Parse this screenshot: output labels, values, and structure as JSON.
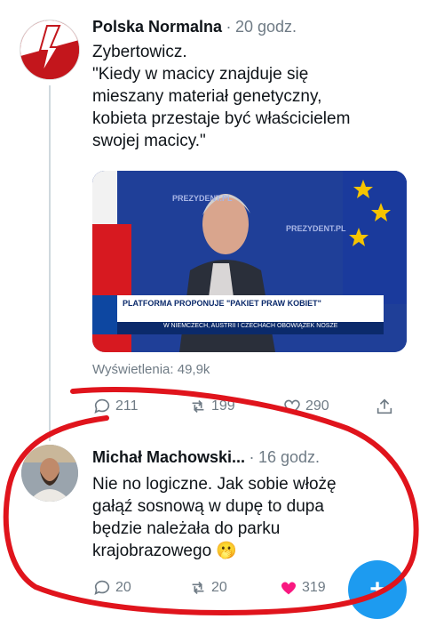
{
  "tweet1": {
    "author": "Polska Normalna",
    "separator": "·",
    "time": "20 godz.",
    "text_lines": [
      "Zybertowicz.",
      "\"Kiedy w macicy znajduje się",
      "mieszany materiał genetyczny,",
      "kobieta przestaje być właścicielem",
      "swojej macicy.\""
    ],
    "views": "Wyświetlenia: 49,9k",
    "replies": "211",
    "retweets": "199",
    "likes": "290"
  },
  "media": {
    "backdrop_text": "PREZYDENT.PL",
    "ticker_text": "PLATFORMA PROPONUJE \"PAKIET PRAW KOBIET\"",
    "ticker_sub": "W NIEMCZECH, AUSTRII I CZECHACH OBOWIĄZEK NOSZE"
  },
  "tweet2": {
    "author": "Michał Machowski...",
    "separator": "·",
    "time": "16 godz.",
    "text_lines": [
      "Nie no logiczne. Jak sobie włożę",
      "gałąź sosnową w dupę to dupa",
      "będzie należała do parku",
      "krajobrazowego"
    ],
    "emoji": "🫢",
    "replies": "20",
    "retweets": "20",
    "likes": "319"
  },
  "compose_label": "+",
  "colors": {
    "text": "#0f1419",
    "secondary": "#6f7b85",
    "like_active": "#f91880",
    "accent": "#1d9bf0",
    "annotation": "#e0141c"
  }
}
